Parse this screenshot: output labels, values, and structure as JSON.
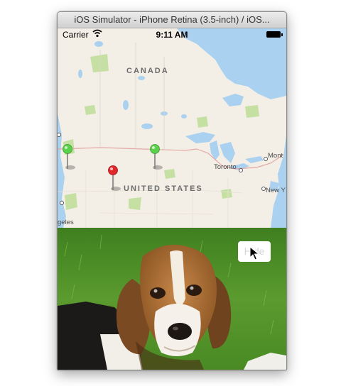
{
  "window": {
    "title": "iOS Simulator - iPhone Retina (3.5-inch) / iOS..."
  },
  "status_bar": {
    "carrier": "Carrier",
    "time": "9:11 AM",
    "wifi_icon": "wifi-icon",
    "battery_icon": "battery-icon"
  },
  "map": {
    "labels": {
      "canada": "CANADA",
      "united_states": "UNITED STATES"
    },
    "cities": {
      "toronto": "Toronto",
      "montreal": "Mont",
      "new_york": "New Y",
      "los_angeles": "geles"
    },
    "pins": [
      {
        "color": "#5bd04a",
        "label": ""
      },
      {
        "color": "#5bd04a",
        "label": ""
      },
      {
        "color": "#e0282c",
        "label": ""
      }
    ]
  },
  "photo": {
    "hide_button_label": "Hide"
  },
  "colors": {
    "water": "#aad1ef",
    "land": "#f4efe6",
    "park": "#c6e0a4",
    "grass": "#4f8f2a"
  }
}
